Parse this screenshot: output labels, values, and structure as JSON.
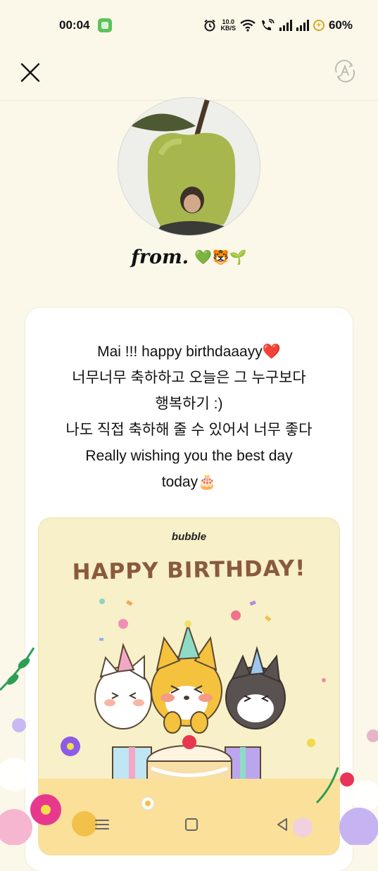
{
  "status_bar": {
    "time": "00:04",
    "speed_value": "10.0",
    "speed_unit": "KB/S",
    "battery": "60%"
  },
  "header": {
    "close_icon": "close-icon",
    "translate_icon": "auto-translate-icon"
  },
  "sender": {
    "from_label": "from.",
    "emojis": "💚🐯🌱"
  },
  "message": {
    "lines": [
      "Mai !!! happy birthdaaayy❤️",
      "너무너무 축하하고 오늘은 그 누구보다",
      "행복하기 :)",
      "나도 직접 축하해 줄 수 있어서 너무 좋다",
      "Really wishing you the best day",
      "today🎂"
    ]
  },
  "card": {
    "brand": "bubble",
    "headline": "HAPPY BIRTHDAY!"
  },
  "colors": {
    "background": "#fbf7e9",
    "card_bg": "#f7f0c8",
    "headline": "#8a5a3c"
  },
  "nav": {
    "recent_icon": "recent-apps-icon",
    "home_icon": "home-icon",
    "back_icon": "back-icon"
  }
}
